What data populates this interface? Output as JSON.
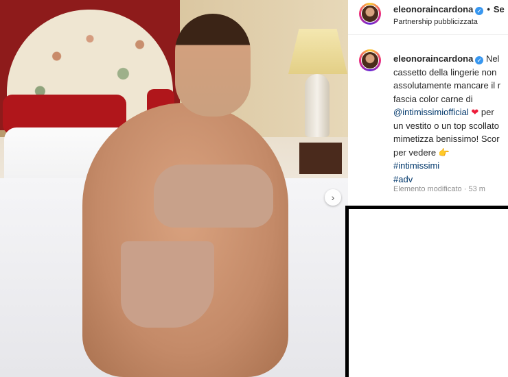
{
  "header": {
    "username": "eleonoraincardona",
    "separator": "•",
    "follow_label": "Se",
    "subtitle": "Partnership pubblicizzata"
  },
  "caption": {
    "username": "eleonoraincardona",
    "line1": "Nel",
    "line2": "cassetto della lingerie non",
    "line3": "assolutamente mancare il r",
    "line4": "fascia color carne di",
    "mention": "@intimissimiofficial",
    "heart": "❤",
    "line5_tail": "per",
    "line6": "un vestito o un top scollato",
    "line7": "mimetizza benissimo! Scor",
    "line8": "per vedere",
    "finger": "👉",
    "hashtag1": "#intimissimi",
    "hashtag2": "#adv",
    "edited_label": "Elemento modificato",
    "time": "53 m"
  },
  "icons": {
    "verified": "✓",
    "next": "›"
  },
  "colors": {
    "link": "#00376b",
    "verified": "#3897f0",
    "meta": "#8e8e8e"
  }
}
